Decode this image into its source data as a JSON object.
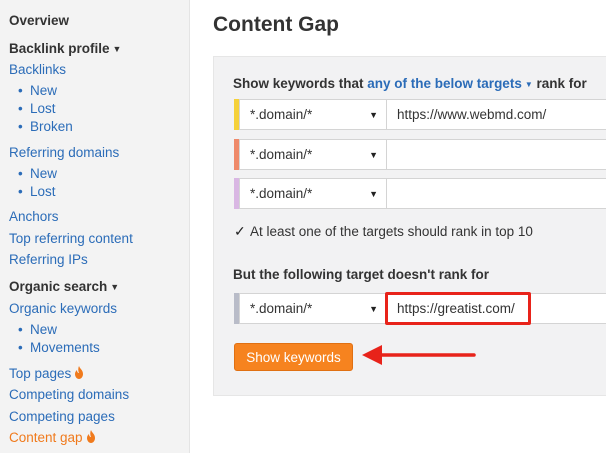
{
  "sidebar": {
    "overview": "Overview",
    "backlink_profile": "Backlink profile",
    "backlinks": "Backlinks",
    "backlinks_sub": [
      "New",
      "Lost",
      "Broken"
    ],
    "referring_domains": "Referring domains",
    "referring_domains_sub": [
      "New",
      "Lost"
    ],
    "anchors": "Anchors",
    "top_referring_content": "Top referring content",
    "referring_ips": "Referring IPs",
    "organic_search": "Organic search",
    "organic_keywords": "Organic keywords",
    "organic_keywords_sub": [
      "New",
      "Movements"
    ],
    "top_pages": "Top pages",
    "competing_domains": "Competing domains",
    "competing_pages": "Competing pages",
    "content_gap": "Content gap"
  },
  "main": {
    "title": "Content Gap",
    "show_label_prefix": "Show keywords that",
    "show_label_accent": "any of the below targets",
    "show_label_suffix": "rank for",
    "targets": [
      {
        "mode": "*.domain/*",
        "url": "https://www.webmd.com/",
        "color": "#f5d13a"
      },
      {
        "mode": "*.domain/*",
        "url": "",
        "color": "#ef8a6a"
      },
      {
        "mode": "*.domain/*",
        "url": "",
        "color": "#d9b7e3"
      }
    ],
    "checkbox_label": "At least one of the targets should rank in top 10",
    "exclude_label": "But the following target doesn't rank for",
    "exclude_target": {
      "mode": "*.domain/*",
      "url": "https://greatist.com/",
      "color": "#b9bcc8"
    },
    "button_label": "Show keywords"
  },
  "colors": {
    "accent_link": "#2b6cb8",
    "active": "#f07a1c",
    "button": "#f6831f",
    "annotation": "#e8231a"
  }
}
